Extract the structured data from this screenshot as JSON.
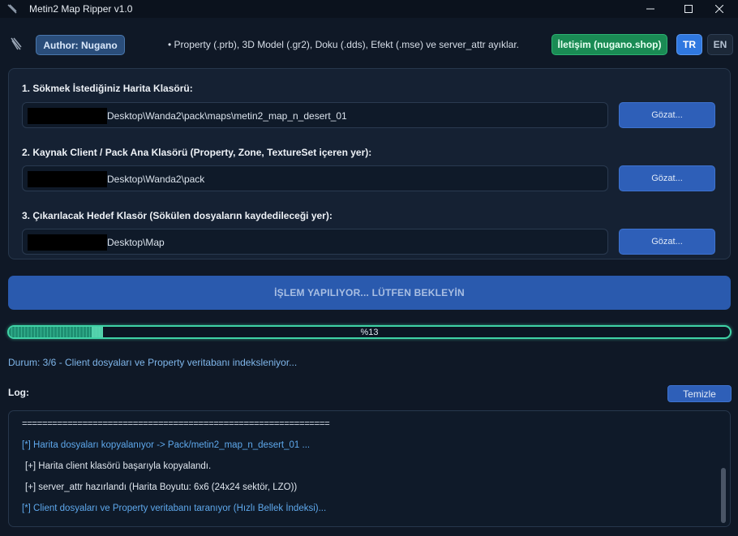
{
  "window": {
    "title": "Metin2 Map Ripper v1.0",
    "controls": [
      "minimize-icon",
      "maximize-icon",
      "close-icon"
    ]
  },
  "header": {
    "author": "Author: Nugano",
    "info": "• Property (.prb), 3D Model (.gr2), Doku (.dds), Efekt (.mse) ve server_attr ayıklar.",
    "contact": "İletişim (nugano.shop)",
    "lang_tr": "TR",
    "lang_en": "EN",
    "active_lang": "TR"
  },
  "form": {
    "map_folder": {
      "label": "1. Sökmek İstediğiniz Harita Klasörü:",
      "value": "Desktop\\Wanda2\\pack\\maps\\metin2_map_n_desert_01",
      "button": "Gözat..."
    },
    "client_folder": {
      "label": "2. Kaynak Client / Pack Ana Klasörü (Property, Zone, TextureSet içeren yer):",
      "value": "Desktop\\Wanda2\\pack",
      "button": "Gözat..."
    },
    "target_folder": {
      "label": "3. Çıkarılacak Hedef Klasör (Sökülen dosyaların kaydedileceği yer):",
      "value": "Desktop\\Map",
      "button": "Gözat..."
    }
  },
  "process_button": "İŞLEM YAPILIYOR... LÜTFEN BEKLEYİN",
  "progress": {
    "percent": 13,
    "text": "%13"
  },
  "status": "Durum: 3/6 - Client dosyaları ve Property veritabanı indeksleniyor...",
  "log": {
    "label": "Log:",
    "clear_button": "Temizle",
    "lines": [
      {
        "kind": "sep",
        "text": "============================================================="
      },
      {
        "kind": "info",
        "text": "[*] Harita dosyaları kopyalanıyor -> Pack/metin2_map_n_desert_01 ..."
      },
      {
        "kind": "ok",
        "text": "[+] Harita client klasörü başarıyla kopyalandı."
      },
      {
        "kind": "ok",
        "text": "[+] server_attr hazırlandı (Harita Boyutu: 6x6 (24x24 sektör, LZO))"
      },
      {
        "kind": "info",
        "text": "[*] Client dosyaları ve Property veritabanı taranıyor (Hızlı Bellek İndeksi)..."
      }
    ]
  },
  "colors": {
    "accent": "#2e5fb8",
    "success": "#1a8b54",
    "progress": "#3fd3a6",
    "background": "#0f1826"
  }
}
